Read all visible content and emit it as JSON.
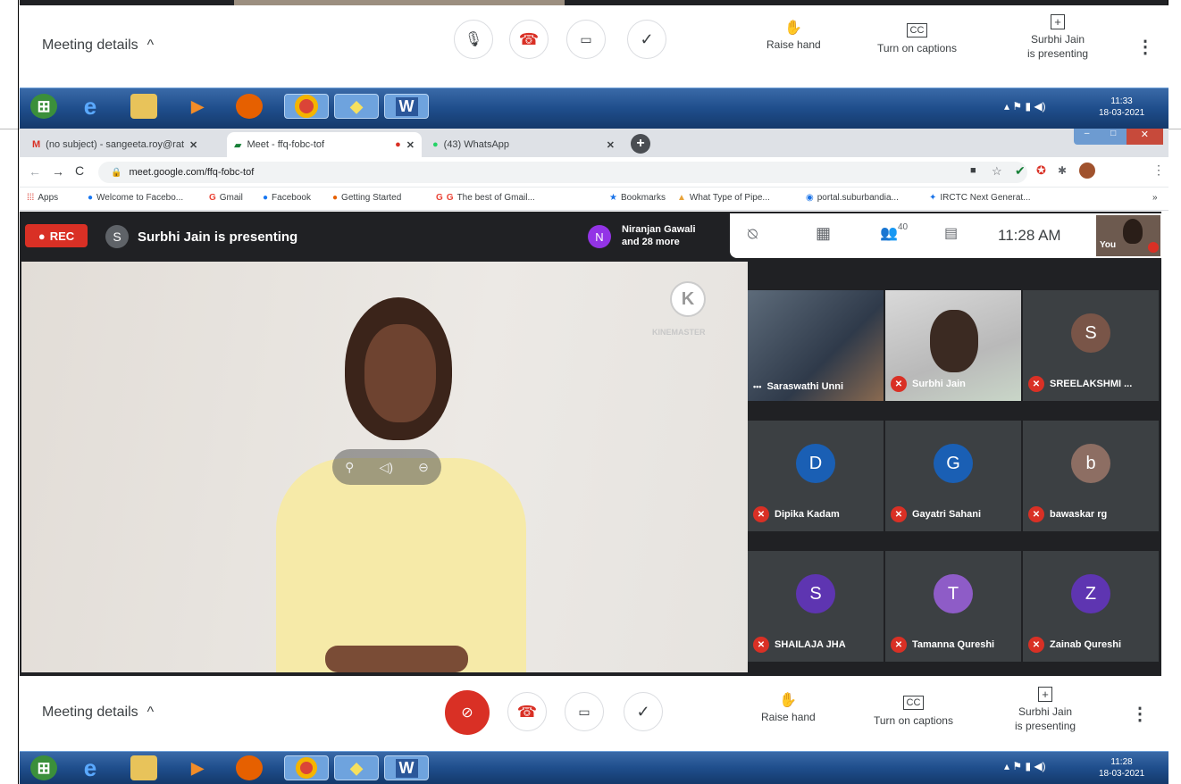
{
  "bars": {
    "top": {
      "meeting_details": "Meeting details",
      "raise_hand": "Raise hand",
      "captions": "Turn on captions",
      "presenting_line1": "Surbhi Jain",
      "presenting_line2": "is presenting"
    },
    "bottom": {
      "meeting_details": "Meeting details",
      "raise_hand": "Raise hand",
      "captions": "Turn on captions",
      "presenting_line1": "Surbhi Jain",
      "presenting_line2": "is presenting"
    }
  },
  "taskbar_top": {
    "time": "11:33",
    "date": "18-03-2021"
  },
  "taskbar_bottom": {
    "time": "11:28",
    "date": "18-03-2021"
  },
  "browser": {
    "tabs": [
      {
        "label": "(no subject) - sangeeta.roy@rat"
      },
      {
        "label": "Meet - ffq-fobc-tof"
      },
      {
        "label": "(43) WhatsApp"
      }
    ],
    "url": "meet.google.com/ffq-fobc-tof",
    "bookmarks": [
      "Apps",
      "Welcome to Facebo...",
      "Gmail",
      "Facebook",
      "Getting Started",
      "The best of Gmail...",
      "Bookmarks",
      "What Type of Pipe...",
      "portal.suburbandia...",
      "IRCTC Next Generat..."
    ]
  },
  "meet": {
    "rec": "REC",
    "presenter_initial": "S",
    "presenting_text": "Surbhi Jain is presenting",
    "joined_initial": "N",
    "joined_line1": "Niranjan Gawali",
    "joined_line2": "and 28 more",
    "participant_count": "40",
    "clock": "11:28 AM",
    "self_label": "You",
    "watermark": "KINEMASTER",
    "participants": [
      {
        "name": "Saraswathi Unni",
        "initial": "",
        "color": ""
      },
      {
        "name": "Surbhi Jain",
        "initial": "",
        "color": ""
      },
      {
        "name": "SREELAKSHMI ...",
        "initial": "S",
        "color": "#795548"
      },
      {
        "name": "Dipika Kadam",
        "initial": "D",
        "color": "#1a5fb4"
      },
      {
        "name": "Gayatri Sahani",
        "initial": "G",
        "color": "#1a5fb4"
      },
      {
        "name": "bawaskar rg",
        "initial": "b",
        "color": "#8d6e63"
      },
      {
        "name": "SHAILAJA JHA",
        "initial": "S",
        "color": "#5e35b1"
      },
      {
        "name": "Tamanna Qureshi",
        "initial": "T",
        "color": "#8e5cc7"
      },
      {
        "name": "Zainab Qureshi",
        "initial": "Z",
        "color": "#5e35b1"
      }
    ]
  },
  "colors": {
    "meet_bg": "#202124",
    "accent_red": "#d93025",
    "taskbar": "#1f4e8c"
  }
}
